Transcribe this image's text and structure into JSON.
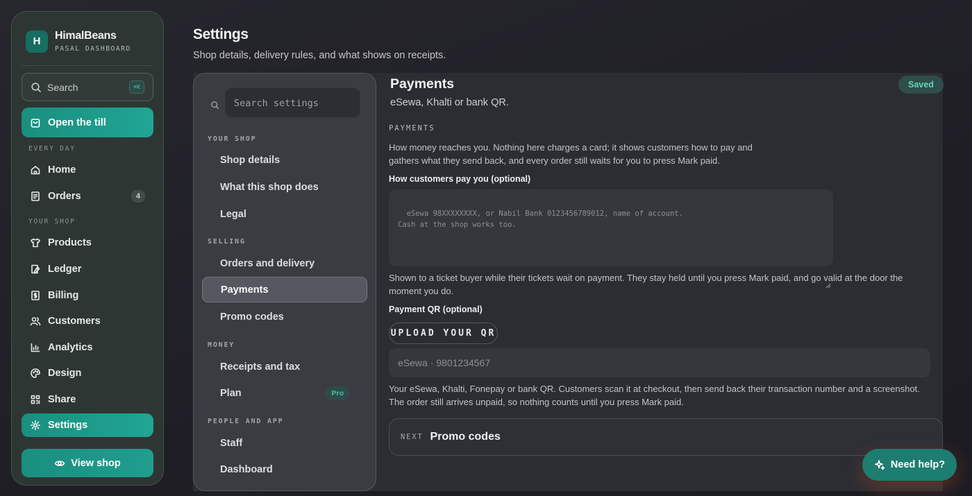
{
  "brand": {
    "logo_letter": "H",
    "name": "HimalBeans",
    "subtitle": "PASAL DASHBOARD"
  },
  "sidebar": {
    "search_label": "Search",
    "search_shortcut": "⌘K",
    "till_label": "Open the till",
    "sections": [
      {
        "title": "EVERY DAY"
      },
      {
        "title": "YOUR SHOP"
      }
    ],
    "items": [
      {
        "label": "Home",
        "icon": "home-icon"
      },
      {
        "label": "Orders",
        "icon": "receipt-icon",
        "count": "4"
      },
      {
        "label": "Products",
        "icon": "shirt-icon"
      },
      {
        "label": "Ledger",
        "icon": "ledger-icon"
      },
      {
        "label": "Billing",
        "icon": "dollar-doc-icon"
      },
      {
        "label": "Customers",
        "icon": "users-icon"
      },
      {
        "label": "Analytics",
        "icon": "bar-chart-icon"
      },
      {
        "label": "Design",
        "icon": "palette-icon"
      },
      {
        "label": "Share",
        "icon": "qr-icon"
      },
      {
        "label": "Settings",
        "icon": "gear-icon",
        "active": true
      }
    ],
    "view_shop_label": "View shop"
  },
  "header": {
    "title": "Settings",
    "subtitle": "Shop details, delivery rules, and what shows on receipts."
  },
  "settings_nav": {
    "search_placeholder": "Search settings",
    "groups": [
      {
        "title": "YOUR SHOP",
        "items": [
          "Shop details",
          "What this shop does",
          "Legal"
        ]
      },
      {
        "title": "SELLING",
        "items": [
          "Orders and delivery",
          "Payments",
          "Promo codes"
        ]
      },
      {
        "title": "MONEY",
        "items": [
          "Receipts and tax",
          "Plan"
        ]
      },
      {
        "title": "PEOPLE AND APP",
        "items": [
          "Staff",
          "Dashboard"
        ]
      }
    ],
    "active_item": "Payments",
    "plan_badge": "Pro"
  },
  "content": {
    "title": "Payments",
    "subtitle": "eSewa, Khalti or bank QR.",
    "status": "Saved",
    "section_label": "PAYMENTS",
    "description": "How money reaches you. Nothing here charges a card; it shows customers how to pay and gathers what they send back, and every order still waits for you to press Mark paid.",
    "pay_label": "How customers pay you (optional)",
    "pay_placeholder": "eSewa 98XXXXXXXX, or Nabil Bank 0123456789012, name of account.\nCash at the shop works too.",
    "pay_help": "Shown to a ticket buyer while their tickets wait on payment. They stay held until you press Mark paid, and go valid at the door the moment you do.",
    "qr_label": "Payment QR (optional)",
    "upload_label": "UPLOAD YOUR QR",
    "qr_placeholder": "eSewa · 9801234567",
    "qr_help": "Your eSewa, Khalti, Fonepay or bank QR. Customers scan it at checkout, then send back their transaction number and a screenshot. The order still arrives unpaid, so nothing counts until you press Mark paid.",
    "next_label": "NEXT",
    "next_title": "Promo codes"
  },
  "help_button": {
    "label": "Need help?"
  },
  "colors": {
    "accent": "#1f9e8e",
    "accent_dark": "#166e63",
    "badge_text": "#41c3ad"
  }
}
